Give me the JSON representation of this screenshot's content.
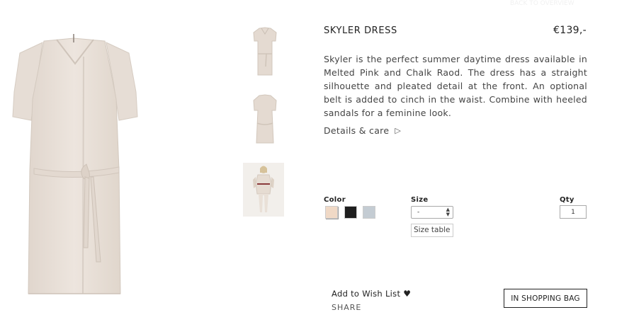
{
  "header": {
    "faint_link": "BACK TO OVERVIEW"
  },
  "product": {
    "title": "SKYLER DRESS",
    "price": "€139,-",
    "description": "Skyler is the perfect summer daytime dress available in Melted Pink and Chalk Raod. The dress has a straight silhouette and pleated detail at the front. An optional belt is added to cinch in the waist. Combine with heeled sandals for a feminine look.",
    "details_link": "Details & care",
    "details_icon": "play-triangle-icon"
  },
  "options": {
    "color_label": "Color",
    "colors": [
      "#f0d9c6",
      "#1e1e1e",
      "#c4ccd3"
    ],
    "size_label": "Size",
    "size_value": "-",
    "size_table_label": "Size table",
    "qty_label": "Qty",
    "qty_value": "1"
  },
  "actions": {
    "wishlist_label": "Add to Wish List",
    "wishlist_icon": "heart-icon",
    "share_label": "SHARE",
    "bag_button": "IN SHOPPING BAG"
  }
}
